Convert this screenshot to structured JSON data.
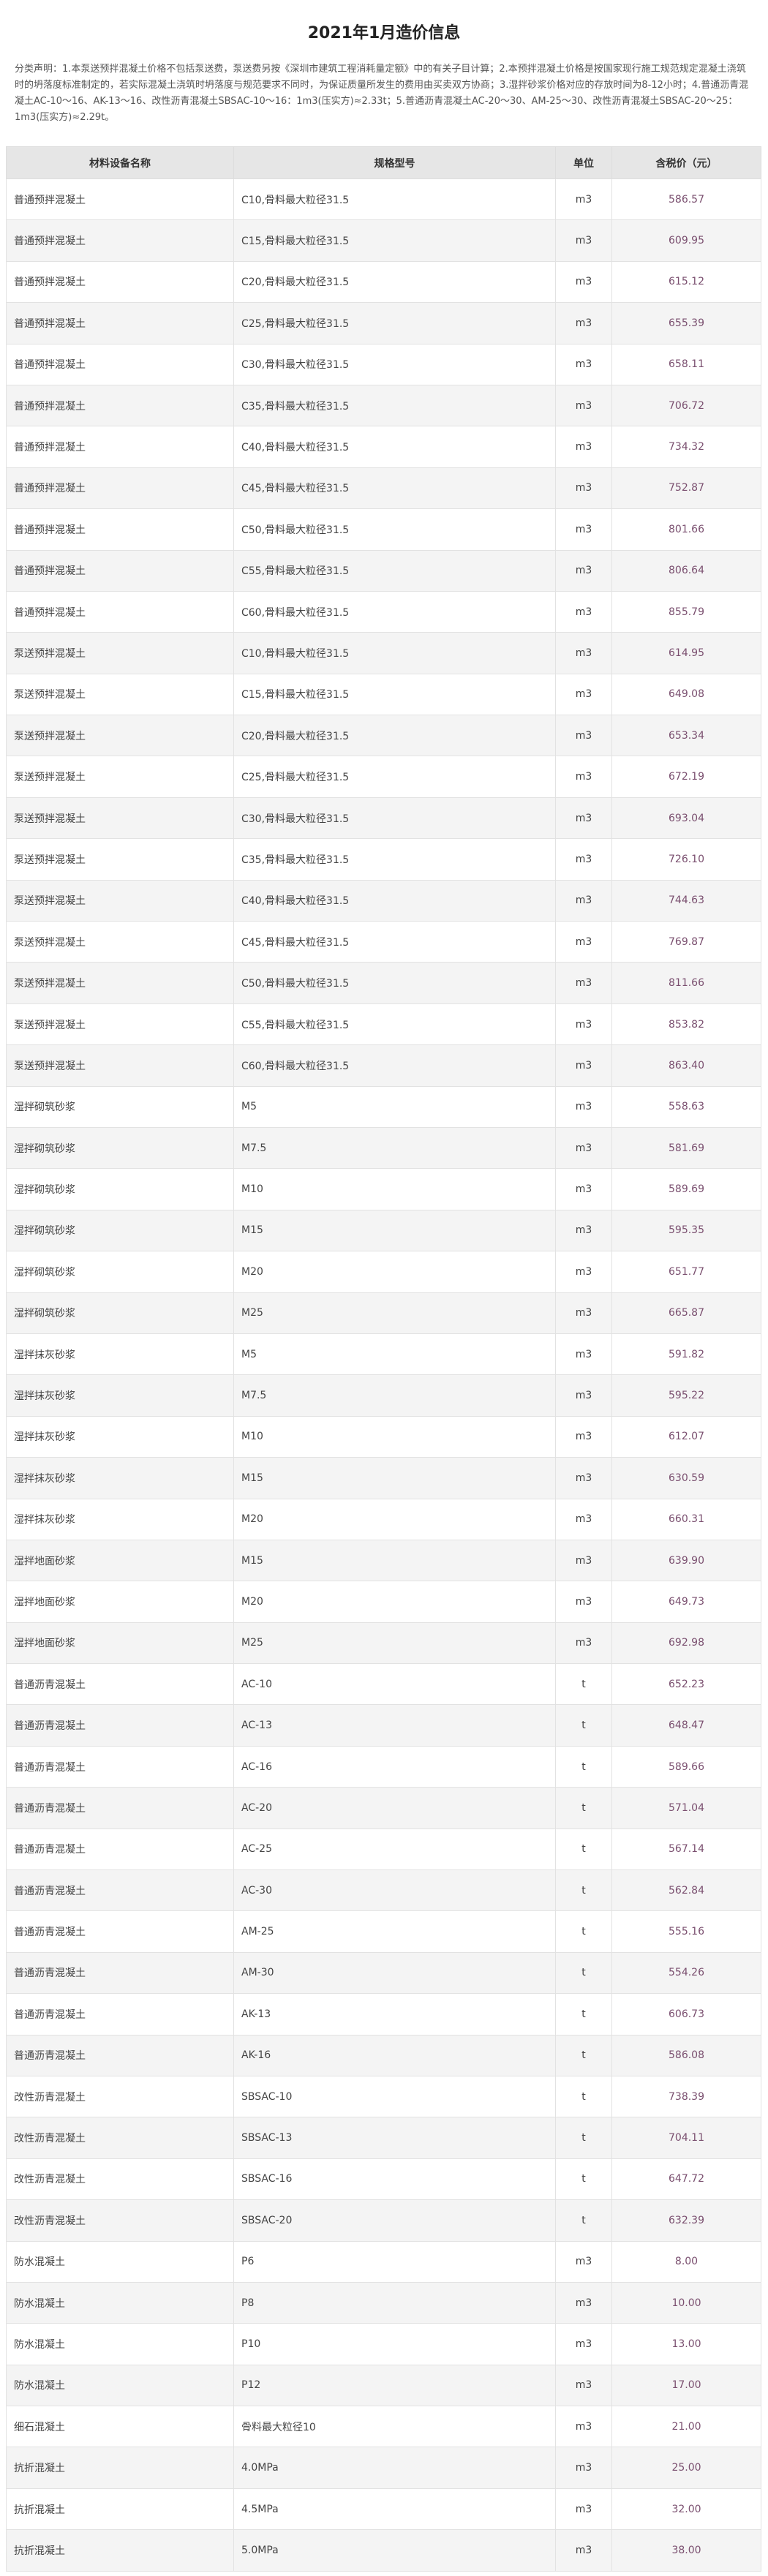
{
  "page": {
    "title": "2021年1月造价信息",
    "note": "分类声明：1.本泵送预拌混凝土价格不包括泵送费，泵送费另按《深圳市建筑工程消耗量定额》中的有关子目计算；2.本预拌混凝土价格是按国家现行施工规范规定混凝土浇筑时的坍落度标准制定的，若实际混凝土浇筑时坍落度与规范要求不同时，为保证质量所发生的费用由买卖双方协商；3.湿拌砂浆价格对应的存放时间为8-12小时；4.普通沥青混凝土AC-10～16、AK-13～16、改性沥青混凝土SBSAC-10～16：1m3(压实方)≈2.33t；5.普通沥青混凝土AC-20～30、AM-25～30、改性沥青混凝土SBSAC-20～25：1m3(压实方)≈2.29t。"
  },
  "table": {
    "headers": [
      "材料设备名称",
      "规格型号",
      "单位",
      "含税价（元）"
    ],
    "rows": [
      [
        "普通预拌混凝土",
        "C10,骨料最大粒径31.5",
        "m3",
        "586.57"
      ],
      [
        "普通预拌混凝土",
        "C15,骨料最大粒径31.5",
        "m3",
        "609.95"
      ],
      [
        "普通预拌混凝土",
        "C20,骨料最大粒径31.5",
        "m3",
        "615.12"
      ],
      [
        "普通预拌混凝土",
        "C25,骨料最大粒径31.5",
        "m3",
        "655.39"
      ],
      [
        "普通预拌混凝土",
        "C30,骨料最大粒径31.5",
        "m3",
        "658.11"
      ],
      [
        "普通预拌混凝土",
        "C35,骨料最大粒径31.5",
        "m3",
        "706.72"
      ],
      [
        "普通预拌混凝土",
        "C40,骨料最大粒径31.5",
        "m3",
        "734.32"
      ],
      [
        "普通预拌混凝土",
        "C45,骨料最大粒径31.5",
        "m3",
        "752.87"
      ],
      [
        "普通预拌混凝土",
        "C50,骨料最大粒径31.5",
        "m3",
        "801.66"
      ],
      [
        "普通预拌混凝土",
        "C55,骨料最大粒径31.5",
        "m3",
        "806.64"
      ],
      [
        "普通预拌混凝土",
        "C60,骨料最大粒径31.5",
        "m3",
        "855.79"
      ],
      [
        "泵送预拌混凝土",
        "C10,骨料最大粒径31.5",
        "m3",
        "614.95"
      ],
      [
        "泵送预拌混凝土",
        "C15,骨料最大粒径31.5",
        "m3",
        "649.08"
      ],
      [
        "泵送预拌混凝土",
        "C20,骨料最大粒径31.5",
        "m3",
        "653.34"
      ],
      [
        "泵送预拌混凝土",
        "C25,骨料最大粒径31.5",
        "m3",
        "672.19"
      ],
      [
        "泵送预拌混凝土",
        "C30,骨料最大粒径31.5",
        "m3",
        "693.04"
      ],
      [
        "泵送预拌混凝土",
        "C35,骨料最大粒径31.5",
        "m3",
        "726.10"
      ],
      [
        "泵送预拌混凝土",
        "C40,骨料最大粒径31.5",
        "m3",
        "744.63"
      ],
      [
        "泵送预拌混凝土",
        "C45,骨料最大粒径31.5",
        "m3",
        "769.87"
      ],
      [
        "泵送预拌混凝土",
        "C50,骨料最大粒径31.5",
        "m3",
        "811.66"
      ],
      [
        "泵送预拌混凝土",
        "C55,骨料最大粒径31.5",
        "m3",
        "853.82"
      ],
      [
        "泵送预拌混凝土",
        "C60,骨料最大粒径31.5",
        "m3",
        "863.40"
      ],
      [
        "湿拌砌筑砂浆",
        "M5",
        "m3",
        "558.63"
      ],
      [
        "湿拌砌筑砂浆",
        "M7.5",
        "m3",
        "581.69"
      ],
      [
        "湿拌砌筑砂浆",
        "M10",
        "m3",
        "589.69"
      ],
      [
        "湿拌砌筑砂浆",
        "M15",
        "m3",
        "595.35"
      ],
      [
        "湿拌砌筑砂浆",
        "M20",
        "m3",
        "651.77"
      ],
      [
        "湿拌砌筑砂浆",
        "M25",
        "m3",
        "665.87"
      ],
      [
        "湿拌抹灰砂浆",
        "M5",
        "m3",
        "591.82"
      ],
      [
        "湿拌抹灰砂浆",
        "M7.5",
        "m3",
        "595.22"
      ],
      [
        "湿拌抹灰砂浆",
        "M10",
        "m3",
        "612.07"
      ],
      [
        "湿拌抹灰砂浆",
        "M15",
        "m3",
        "630.59"
      ],
      [
        "湿拌抹灰砂浆",
        "M20",
        "m3",
        "660.31"
      ],
      [
        "湿拌地面砂浆",
        "M15",
        "m3",
        "639.90"
      ],
      [
        "湿拌地面砂浆",
        "M20",
        "m3",
        "649.73"
      ],
      [
        "湿拌地面砂浆",
        "M25",
        "m3",
        "692.98"
      ],
      [
        "普通沥青混凝土",
        "AC-10",
        "t",
        "652.23"
      ],
      [
        "普通沥青混凝土",
        "AC-13",
        "t",
        "648.47"
      ],
      [
        "普通沥青混凝土",
        "AC-16",
        "t",
        "589.66"
      ],
      [
        "普通沥青混凝土",
        "AC-20",
        "t",
        "571.04"
      ],
      [
        "普通沥青混凝土",
        "AC-25",
        "t",
        "567.14"
      ],
      [
        "普通沥青混凝土",
        "AC-30",
        "t",
        "562.84"
      ],
      [
        "普通沥青混凝土",
        "AM-25",
        "t",
        "555.16"
      ],
      [
        "普通沥青混凝土",
        "AM-30",
        "t",
        "554.26"
      ],
      [
        "普通沥青混凝土",
        "AK-13",
        "t",
        "606.73"
      ],
      [
        "普通沥青混凝土",
        "AK-16",
        "t",
        "586.08"
      ],
      [
        "改性沥青混凝土",
        "SBSAC-10",
        "t",
        "738.39"
      ],
      [
        "改性沥青混凝土",
        "SBSAC-13",
        "t",
        "704.11"
      ],
      [
        "改性沥青混凝土",
        "SBSAC-16",
        "t",
        "647.72"
      ],
      [
        "改性沥青混凝土",
        "SBSAC-20",
        "t",
        "632.39"
      ],
      [
        "防水混凝土",
        "P6",
        "m3",
        "8.00"
      ],
      [
        "防水混凝土",
        "P8",
        "m3",
        "10.00"
      ],
      [
        "防水混凝土",
        "P10",
        "m3",
        "13.00"
      ],
      [
        "防水混凝土",
        "P12",
        "m3",
        "17.00"
      ],
      [
        "细石混凝土",
        "骨料最大粒径10",
        "m3",
        "21.00"
      ],
      [
        "抗折混凝土",
        "4.0MPa",
        "m3",
        "25.00"
      ],
      [
        "抗折混凝土",
        "4.5MPa",
        "m3",
        "32.00"
      ],
      [
        "抗折混凝土",
        "5.0MPa",
        "m3",
        "38.00"
      ]
    ]
  }
}
